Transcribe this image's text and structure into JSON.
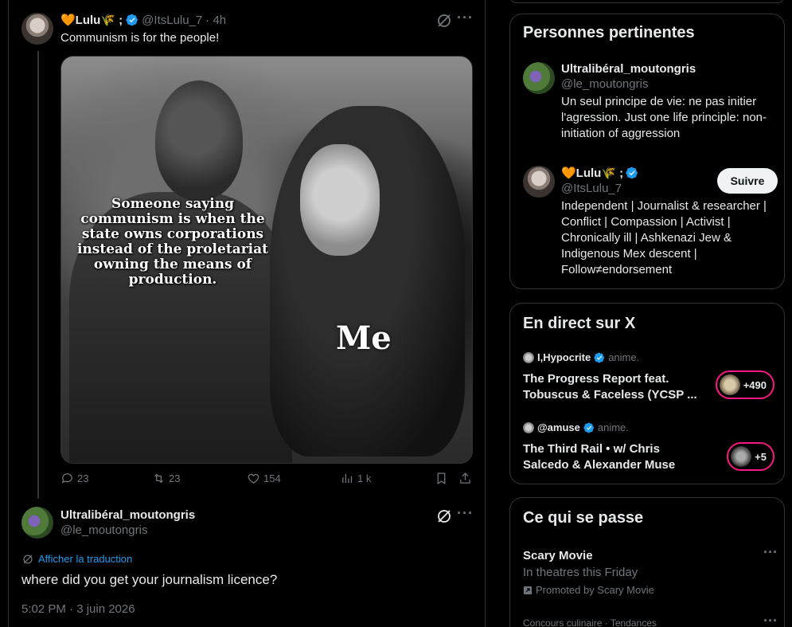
{
  "tweet": {
    "author_name": "🧡Lulu🌾 ;",
    "author_handle": "@ItsLulu_7",
    "time_ago": "· 4h",
    "text": "Communism is for the people!",
    "meme_caption": "Someone saying communism is when the state owns corporations instead of the proletariat owning the means of production.",
    "meme_me": "Me",
    "replies": "23",
    "reposts": "23",
    "likes": "154",
    "views": "1 k"
  },
  "reply": {
    "author_name": "Ultralibéral_moutongris",
    "author_handle": "@le_moutongris",
    "translate_label": "Afficher la traduction",
    "text": "where did you get your journalism licence?",
    "timestamp": "5:02 PM · 3 juin 2026"
  },
  "sidebar": {
    "relevant": {
      "title": "Personnes pertinentes",
      "people": [
        {
          "name": "Ultralibéral_moutongris",
          "handle": "@le_moutongris",
          "bio": "Un seul principe de vie: ne pas initier l'agression. Just one life principle: non-initiation of aggression"
        },
        {
          "name": "🧡Lulu🌾 ;",
          "handle": "@ItsLulu_7",
          "bio": "Independent | Journalist & researcher | Conflict | Compassion | Activist | Chronically ill | Ashkenazi Jew & Indigenous Mex descent | Follow≠endorsement",
          "follow_label": "Suivre"
        }
      ]
    },
    "live": {
      "title": "En direct sur X",
      "items": [
        {
          "host": "I,Hypocrite",
          "status": "anime.",
          "title": "The Progress Report feat. Tobuscus & Faceless (YCSP ...",
          "count": "+490"
        },
        {
          "host": "@amuse",
          "status": "anime.",
          "title": "The Third Rail • w/ Chris Salcedo & Alexander Muse",
          "count": "+5"
        }
      ]
    },
    "happening": {
      "title": "Ce qui se passe",
      "items": [
        {
          "title": "Scary Movie",
          "subtitle": "In theatres this Friday",
          "promo": "Promoted by Scary Movie"
        },
        {
          "meta": "Concours culinaire · Tendances"
        }
      ]
    }
  },
  "colors": {
    "accent": "#1d9bf0",
    "live_ring": "#f91880",
    "muted": "#71767b",
    "text": "#e7e9ea"
  }
}
